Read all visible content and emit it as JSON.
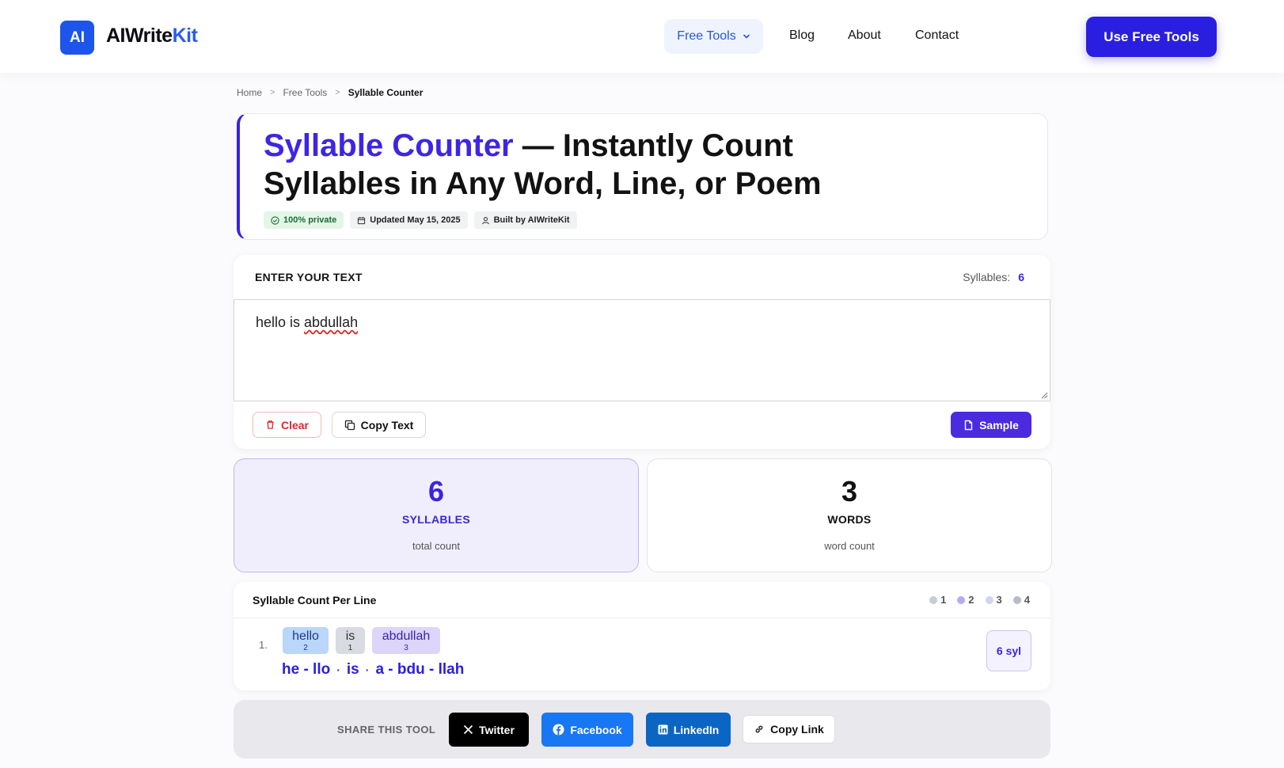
{
  "header": {
    "logo_text": "AI",
    "brand_part1": "AIWrite",
    "brand_part2": "Kit",
    "nav": {
      "free_tools": "Free Tools",
      "blog": "Blog",
      "about": "About",
      "contact": "Contact"
    },
    "cta_label": "Use Free Tools",
    "brand_color": "#2a1ee0"
  },
  "breadcrumb": [
    "Home",
    "Free Tools",
    "Syllable Counter"
  ],
  "hero": {
    "title_accent": "Syllable Counter",
    "title_rest": " — Instantly Count Syllables in Any Word, Line, or Poem",
    "badges": [
      "100% private",
      "Updated May 15, 2025",
      "Built by AIWriteKit"
    ]
  },
  "input": {
    "label": "ENTER YOUR TEXT",
    "syllables_label": "Syllables:",
    "syllables_value": "6",
    "text_plain": "hello is ",
    "text_misspelled": "abdullah",
    "clear_label": "Clear",
    "copy_label": "Copy Text",
    "sample_label": "Sample"
  },
  "stats": [
    {
      "value": "6",
      "label": "SYLLABLES",
      "sub": "total count"
    },
    {
      "value": "3",
      "label": "WORDS",
      "sub": "word count"
    }
  ],
  "per_line": {
    "title": "Syllable Count Per Line",
    "legend": [
      {
        "label": "1",
        "color": "#c8ccd4"
      },
      {
        "label": "2",
        "color": "#b9a9f5"
      },
      {
        "label": "3",
        "color": "#cfd6f2"
      },
      {
        "label": "4",
        "color": "#b8bcc4"
      }
    ],
    "lines": [
      {
        "number": "1.",
        "words": [
          {
            "word": "hello",
            "count": "2"
          },
          {
            "word": "is",
            "count": "1"
          },
          {
            "word": "abdullah",
            "count": "3"
          }
        ],
        "split": [
          "he - llo",
          "is",
          "a - bdu - llah"
        ],
        "separator": "·",
        "total": "6 syl"
      }
    ]
  },
  "share": {
    "label": "SHARE THIS TOOL",
    "twitter": "Twitter",
    "facebook": "Facebook",
    "linkedin": "LinkedIn",
    "copy_link": "Copy Link"
  }
}
